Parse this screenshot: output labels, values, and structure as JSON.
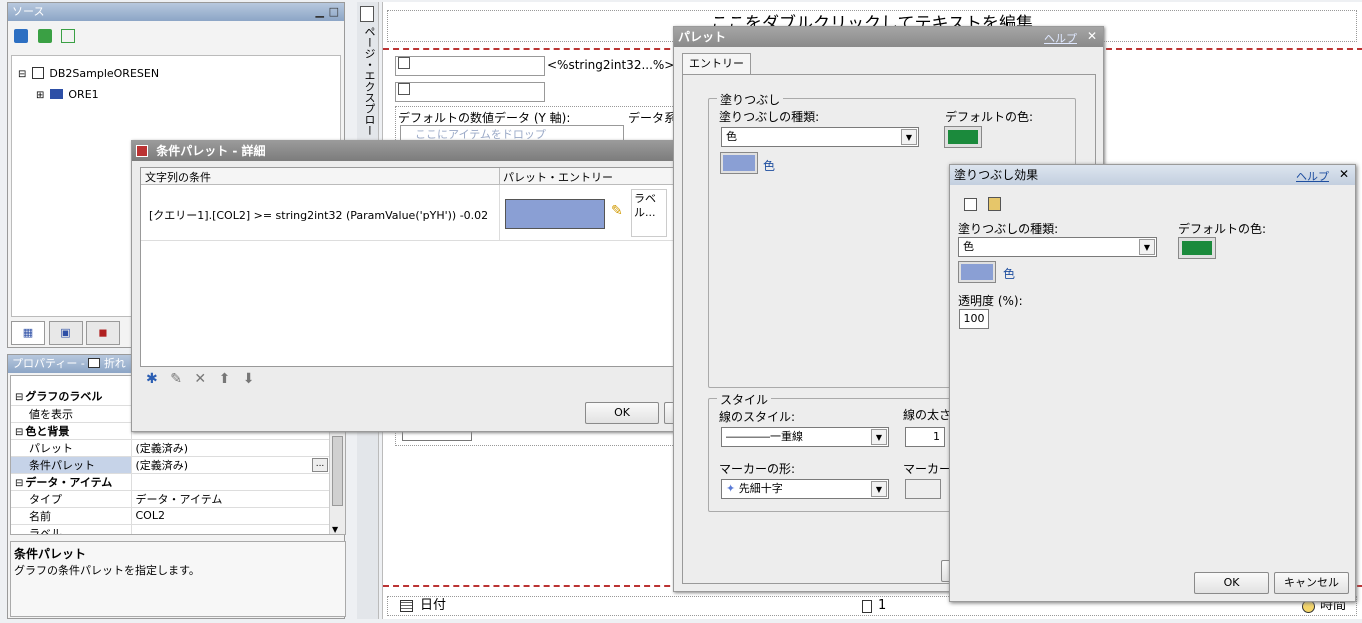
{
  "source_panel": {
    "title": "ソース",
    "tree": [
      {
        "label": "DB2SampleORESEN",
        "expander": "⊟"
      },
      {
        "label": "ORE1",
        "expander": "⊞"
      }
    ]
  },
  "properties": {
    "title": "プロパティー - ",
    "collapse_label": "折れ",
    "rows": [
      {
        "name": "グラフのラベル",
        "value": "",
        "group": true,
        "exp": "⊟"
      },
      {
        "name": "値を表示",
        "value": "",
        "group": false
      },
      {
        "name": "色と背景",
        "value": "",
        "group": true,
        "exp": "⊟"
      },
      {
        "name": "パレット",
        "value": "(定義済み)",
        "group": false
      },
      {
        "name": "条件パレット",
        "value": "(定義済み)",
        "group": false,
        "selected": true
      },
      {
        "name": "データ・アイテム",
        "value": "",
        "group": true,
        "exp": "⊟"
      },
      {
        "name": "タイプ",
        "value": "データ・アイテム",
        "group": false
      },
      {
        "name": "名前",
        "value": "COL2",
        "group": false
      },
      {
        "name": "ラベル",
        "value": "",
        "group": false
      }
    ],
    "ellipsis": "...",
    "desc_title": "条件パレット",
    "desc_text": "グラフの条件パレットを指定します。"
  },
  "canvas": {
    "header_text": "ここをダブルクリックしてテキストを編集",
    "side_label": "ページ・エクスプロー",
    "string_expr": "<%string2int32...%>",
    "default_value_label": "デフォルトの数値データ (Y 軸):",
    "series_label": "データ系",
    "drop_hint": "ここにアイテムをドロップ",
    "footer_date": "日付",
    "footer_page": "1",
    "footer_time": "時間"
  },
  "cond_palette": {
    "title": "条件パレット - 詳細",
    "col1": "文字列の条件",
    "col2": "パレット・エントリー",
    "condition": "[クエリー1].[COL2] >= string2int32 (ParamValue('pYH')) -0.02",
    "label_cell": "ラベル...",
    "ok": "OK",
    "swatch_color": "#8a9fd4"
  },
  "palette_dialog": {
    "title": "パレット",
    "help": "ヘルプ",
    "tab": "エントリー",
    "fill_group": "塗りつぶし",
    "fill_type_label": "塗りつぶしの種類:",
    "fill_type_value": "色",
    "default_color_label": "デフォルトの色:",
    "color_label": "色",
    "style_group": "スタイル",
    "line_style_label": "線のスタイル:",
    "line_style_value": "――――一重線",
    "line_width_label": "線の太さ",
    "line_width_value": "1",
    "marker_shape_label": "マーカーの形:",
    "marker_shape_value": "先細十字",
    "marker_color_label": "マーカー",
    "default_color": "#1b8a3c",
    "fill_color": "#8a9fd4"
  },
  "fill_effect_dialog": {
    "title": "塗りつぶし効果",
    "help": "ヘルプ",
    "fill_type_label": "塗りつぶしの種類:",
    "fill_type_value": "色",
    "default_color_label": "デフォルトの色:",
    "color_label": "色",
    "transparency_label": "透明度 (%):",
    "transparency_value": "100",
    "ok": "OK",
    "cancel": "キャンセル",
    "default_color": "#1b8a3c",
    "fill_color": "#8a9fd4"
  }
}
